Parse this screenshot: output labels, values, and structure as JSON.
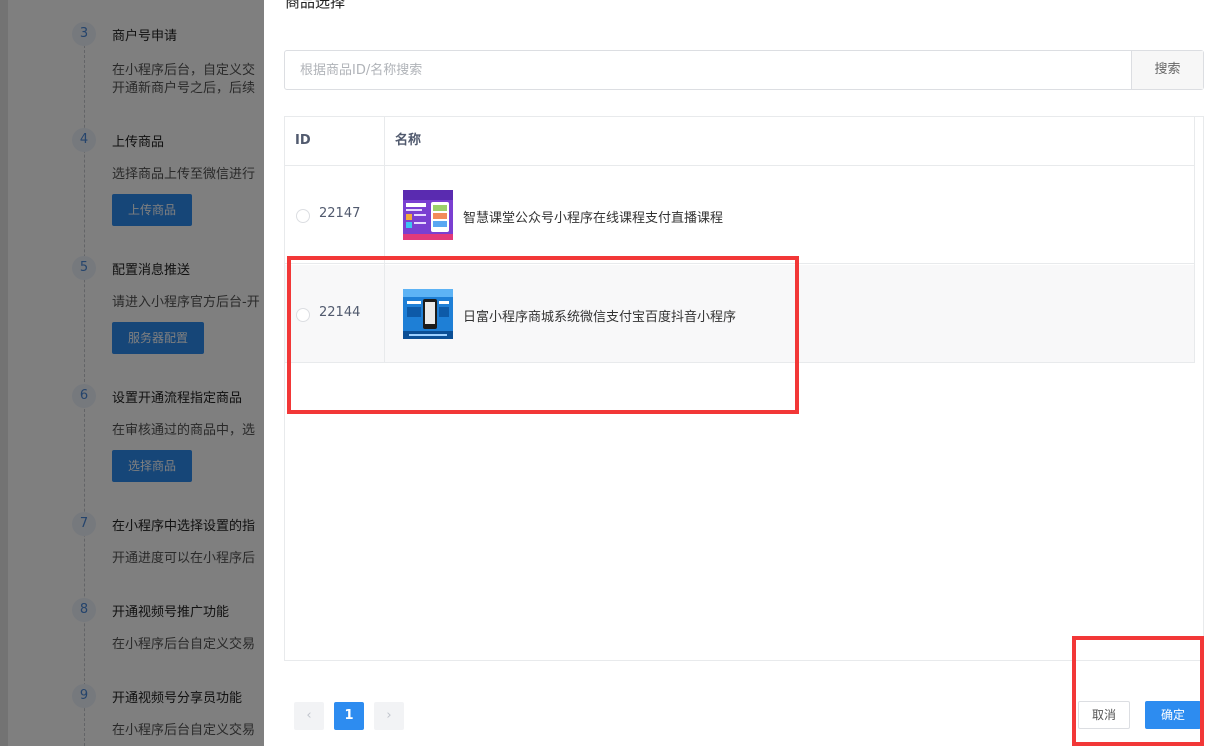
{
  "background": {
    "steps": [
      {
        "num": "3",
        "title": "商户号申请",
        "desc1": "在小程序后台，自定义交",
        "desc2": "开通新商户号之后，后续"
      },
      {
        "num": "4",
        "title": "上传商品",
        "desc1": "选择商品上传至微信进行",
        "button": "上传商品"
      },
      {
        "num": "5",
        "title": "配置消息推送",
        "desc1": "请进入小程序官方后台-开",
        "button": "服务器配置"
      },
      {
        "num": "6",
        "title": "设置开通流程指定商品",
        "desc1": "在审核通过的商品中，选",
        "button": "选择商品"
      },
      {
        "num": "7",
        "title": "在小程序中选择设置的指",
        "desc1": "开通进度可以在小程序后"
      },
      {
        "num": "8",
        "title": "开通视频号推广功能",
        "desc1": "在小程序后台自定义交易"
      },
      {
        "num": "9",
        "title": "开通视频号分享员功能",
        "desc1": "在小程序后台自定义交易"
      }
    ]
  },
  "dialog": {
    "title": "商品选择",
    "search": {
      "placeholder": "根据商品ID/名称搜索",
      "button": "搜索"
    },
    "table": {
      "columns": {
        "id": "ID",
        "name": "名称"
      },
      "rows": [
        {
          "id": "22147",
          "name": "智慧课堂公众号小程序在线课程支付直播课程",
          "thumb": "purple-course-thumbnail"
        },
        {
          "id": "22144",
          "name": "日富小程序商城系统微信支付宝百度抖音小程序",
          "thumb": "blue-mall-thumbnail"
        }
      ]
    },
    "pagination": {
      "prev": "‹",
      "current": "1",
      "next": "›"
    },
    "buttons": {
      "cancel": "取消",
      "ok": "确定"
    }
  },
  "colors": {
    "primary": "#2d8cf0",
    "highlight": "#f23737",
    "overlay": "rgba(0,0,0,0.5)"
  }
}
